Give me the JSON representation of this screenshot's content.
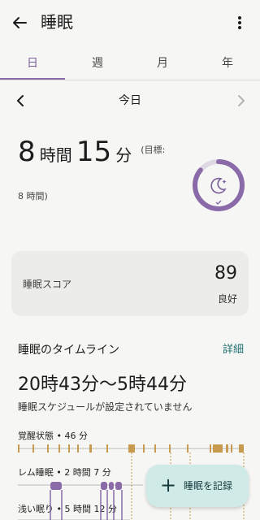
{
  "appbar": {
    "title": "睡眠",
    "back_icon": "arrow-left-icon",
    "more_icon": "more-vert-icon"
  },
  "tabs": [
    {
      "label": "日",
      "active": true
    },
    {
      "label": "週",
      "active": false
    },
    {
      "label": "月",
      "active": false
    },
    {
      "label": "年",
      "active": false
    }
  ],
  "date_nav": {
    "label": "今日",
    "prev_icon": "chevron-left-icon",
    "next_icon": "chevron-right-icon"
  },
  "duration": {
    "hours": "8",
    "hours_unit": "時間",
    "minutes": "15",
    "minutes_unit": "分",
    "goal_prefix": "(目標:",
    "goal_value": "8 時間)"
  },
  "goal_ring": {
    "progress": 0.86,
    "icon": "moon-stars-icon",
    "check_icon": "check-icon",
    "color": "#8a6aa8"
  },
  "score": {
    "label": "睡眠スコア",
    "value": "89",
    "rating": "良好"
  },
  "timeline": {
    "title": "睡眠のタイムライン",
    "detail_link": "詳細",
    "range": "20時43分〜5時44分",
    "schedule_note": "睡眠スケジュールが設定されていません",
    "stages": [
      {
        "label": "覚醒状態 • 46 分",
        "color": "#c89a4e"
      },
      {
        "label": "レム睡眠 • 2 時間 7 分",
        "color": "#8a6aa8"
      },
      {
        "label": "浅い眠り • 5 時間 12 分",
        "color": "#8a6aa8"
      }
    ]
  },
  "fab": {
    "label": "睡眠を記録",
    "icon": "plus-icon"
  }
}
